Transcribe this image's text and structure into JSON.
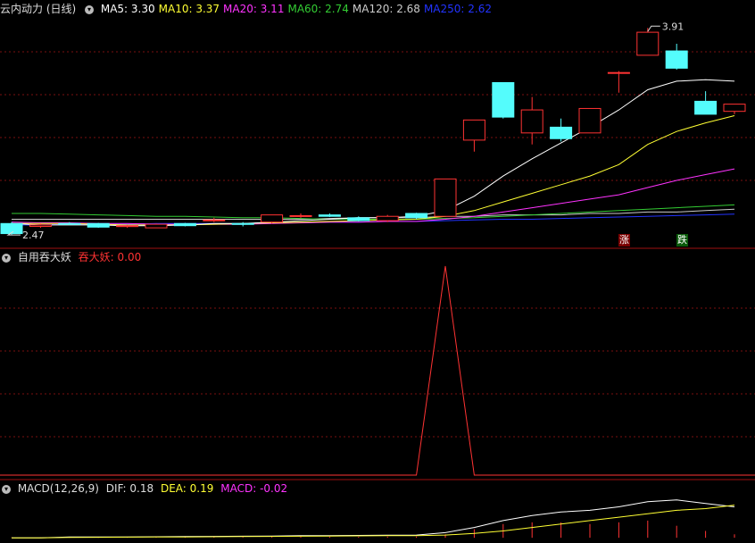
{
  "main": {
    "title": "云内动力 (日线)",
    "ma": [
      {
        "label": "MA5:",
        "value": "3.30",
        "color": "#ffffff"
      },
      {
        "label": "MA10:",
        "value": "3.37",
        "color": "#ffff33"
      },
      {
        "label": "MA20:",
        "value": "3.11",
        "color": "#ff33ff"
      },
      {
        "label": "MA60:",
        "value": "2.74",
        "color": "#33cc33"
      },
      {
        "label": "MA120:",
        "value": "2.68",
        "color": "#cccccc"
      },
      {
        "label": "MA250:",
        "value": "2.62",
        "color": "#2233ff"
      }
    ],
    "high_label": "3.91",
    "low_label": "2.47",
    "badge_up": "涨",
    "badge_down": "跌"
  },
  "indicator": {
    "name": "自用吞大妖",
    "line_label": "吞大妖:",
    "line_value": "0.00"
  },
  "macd": {
    "name": "MACD(12,26,9)",
    "dif_label": "DIF:",
    "dif_value": "0.18",
    "dea_label": "DEA:",
    "dea_value": "0.19",
    "macd_label": "MACD:",
    "macd_value": "-0.02"
  },
  "colors": {
    "up": "#ff3333",
    "down": "#54fcfc",
    "grid": "#7a1010"
  },
  "chart_data": {
    "type": "candlestick",
    "candles": [
      {
        "o": 2.55,
        "h": 2.56,
        "l": 2.47,
        "c": 2.48
      },
      {
        "o": 2.53,
        "h": 2.55,
        "l": 2.52,
        "c": 2.54
      },
      {
        "o": 2.55,
        "h": 2.56,
        "l": 2.54,
        "c": 2.545
      },
      {
        "o": 2.55,
        "h": 2.555,
        "l": 2.52,
        "c": 2.525
      },
      {
        "o": 2.53,
        "h": 2.54,
        "l": 2.52,
        "c": 2.535
      },
      {
        "o": 2.52,
        "h": 2.55,
        "l": 2.52,
        "c": 2.545
      },
      {
        "o": 2.55,
        "h": 2.555,
        "l": 2.53,
        "c": 2.535
      },
      {
        "o": 2.57,
        "h": 2.59,
        "l": 2.56,
        "c": 2.575
      },
      {
        "o": 2.55,
        "h": 2.56,
        "l": 2.53,
        "c": 2.545
      },
      {
        "o": 2.56,
        "h": 2.61,
        "l": 2.55,
        "c": 2.61
      },
      {
        "o": 2.6,
        "h": 2.62,
        "l": 2.59,
        "c": 2.605
      },
      {
        "o": 2.61,
        "h": 2.62,
        "l": 2.595,
        "c": 2.6
      },
      {
        "o": 2.59,
        "h": 2.6,
        "l": 2.565,
        "c": 2.57
      },
      {
        "o": 2.57,
        "h": 2.61,
        "l": 2.56,
        "c": 2.6
      },
      {
        "o": 2.62,
        "h": 2.625,
        "l": 2.58,
        "c": 2.59
      },
      {
        "o": 2.6,
        "h": 2.86,
        "l": 2.6,
        "c": 2.86
      },
      {
        "o": 3.13,
        "h": 3.27,
        "l": 3.05,
        "c": 3.27
      },
      {
        "o": 3.53,
        "h": 3.53,
        "l": 3.28,
        "c": 3.29
      },
      {
        "o": 3.18,
        "h": 3.43,
        "l": 3.1,
        "c": 3.34
      },
      {
        "o": 3.22,
        "h": 3.28,
        "l": 3.12,
        "c": 3.14
      },
      {
        "o": 3.18,
        "h": 3.35,
        "l": 3.18,
        "c": 3.35
      },
      {
        "o": 3.6,
        "h": 3.61,
        "l": 3.46,
        "c": 3.6
      },
      {
        "o": 3.72,
        "h": 3.91,
        "l": 3.72,
        "c": 3.88
      },
      {
        "o": 3.75,
        "h": 3.8,
        "l": 3.62,
        "c": 3.63
      },
      {
        "o": 3.4,
        "h": 3.47,
        "l": 3.31,
        "c": 3.31
      },
      {
        "o": 3.33,
        "h": 3.38,
        "l": 3.31,
        "c": 3.38
      }
    ],
    "ma5": [
      2.55,
      2.54,
      2.54,
      2.54,
      2.535,
      2.535,
      2.54,
      2.55,
      2.55,
      2.56,
      2.57,
      2.58,
      2.59,
      2.59,
      2.6,
      2.64,
      2.74,
      2.88,
      3.0,
      3.11,
      3.22,
      3.34,
      3.48,
      3.54,
      3.55,
      3.54
    ],
    "ma10": [
      2.55,
      2.55,
      2.55,
      2.545,
      2.54,
      2.54,
      2.54,
      2.545,
      2.55,
      2.555,
      2.56,
      2.565,
      2.57,
      2.575,
      2.58,
      2.6,
      2.64,
      2.7,
      2.76,
      2.82,
      2.88,
      2.96,
      3.1,
      3.19,
      3.25,
      3.3
    ],
    "ma20": [
      2.56,
      2.555,
      2.555,
      2.55,
      2.55,
      2.545,
      2.545,
      2.545,
      2.545,
      2.55,
      2.555,
      2.56,
      2.56,
      2.565,
      2.565,
      2.58,
      2.6,
      2.63,
      2.66,
      2.69,
      2.72,
      2.75,
      2.8,
      2.85,
      2.89,
      2.93
    ],
    "ma60": [
      2.62,
      2.62,
      2.615,
      2.61,
      2.605,
      2.6,
      2.6,
      2.595,
      2.59,
      2.59,
      2.585,
      2.58,
      2.58,
      2.58,
      2.58,
      2.585,
      2.59,
      2.6,
      2.61,
      2.62,
      2.63,
      2.64,
      2.65,
      2.66,
      2.67,
      2.68
    ],
    "ma120": [
      2.58,
      2.58,
      2.58,
      2.58,
      2.58,
      2.58,
      2.58,
      2.58,
      2.58,
      2.58,
      2.58,
      2.585,
      2.59,
      2.59,
      2.59,
      2.6,
      2.6,
      2.61,
      2.61,
      2.61,
      2.62,
      2.62,
      2.63,
      2.63,
      2.64,
      2.65
    ],
    "ma250": [
      2.54,
      2.54,
      2.545,
      2.545,
      2.545,
      2.55,
      2.55,
      2.55,
      2.55,
      2.555,
      2.555,
      2.56,
      2.56,
      2.565,
      2.565,
      2.57,
      2.575,
      2.58,
      2.58,
      2.585,
      2.59,
      2.595,
      2.6,
      2.605,
      2.61,
      2.615
    ],
    "signal": [
      0,
      0,
      0,
      0,
      0,
      0,
      0,
      0,
      0,
      0,
      0,
      0,
      0,
      0,
      0,
      1,
      0,
      0,
      0,
      0,
      0,
      0,
      0,
      0,
      0,
      0
    ],
    "signal_range": [
      0,
      1
    ],
    "macd_hist": [
      0.002,
      0.002,
      0.003,
      0.003,
      0.002,
      0.003,
      0.004,
      0.004,
      0.004,
      0.005,
      0.006,
      0.006,
      0.006,
      0.007,
      0.007,
      0.02,
      0.05,
      0.08,
      0.09,
      0.09,
      0.08,
      0.09,
      0.1,
      0.07,
      0.04,
      0.02
    ],
    "dif": [
      0.0,
      0.0,
      0.005,
      0.005,
      0.005,
      0.006,
      0.007,
      0.008,
      0.009,
      0.01,
      0.012,
      0.013,
      0.014,
      0.015,
      0.016,
      0.03,
      0.06,
      0.1,
      0.13,
      0.15,
      0.16,
      0.18,
      0.21,
      0.22,
      0.2,
      0.18
    ],
    "dea": [
      0.0,
      0.0,
      0.002,
      0.003,
      0.004,
      0.005,
      0.005,
      0.006,
      0.007,
      0.008,
      0.009,
      0.01,
      0.011,
      0.012,
      0.013,
      0.016,
      0.025,
      0.04,
      0.06,
      0.08,
      0.1,
      0.12,
      0.14,
      0.16,
      0.17,
      0.19
    ],
    "price_range": [
      2.44,
      3.98
    ],
    "macd_range": [
      -0.02,
      0.24
    ]
  }
}
